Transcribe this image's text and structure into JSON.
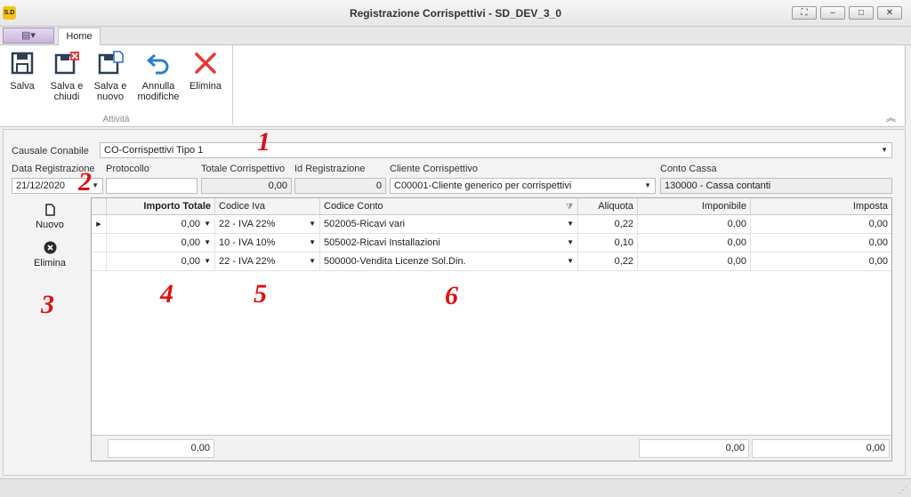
{
  "window": {
    "logo_text": "S.D",
    "title": "Registrazione Corrispettivi - SD_DEV_3_0"
  },
  "tabs": [
    {
      "label": "Home"
    }
  ],
  "ribbon": {
    "group_label": "Attività",
    "buttons": [
      {
        "line1": "Salva",
        "line2": ""
      },
      {
        "line1": "Salva e",
        "line2": "chiudi"
      },
      {
        "line1": "Salva e",
        "line2": "nuovo"
      },
      {
        "line1": "Annulla",
        "line2": "modifiche"
      },
      {
        "line1": "Elimina",
        "line2": ""
      }
    ]
  },
  "form": {
    "causale": {
      "label": "Causale Conabile",
      "value": "CO-Corrispettivi Tipo 1"
    },
    "data_registrazione": {
      "label": "Data Registrazione",
      "value": "21/12/2020"
    },
    "protocollo": {
      "label": "Protocollo",
      "value": ""
    },
    "totale_corrispettivo": {
      "label": "Totale Corrispettivo",
      "value": "0,00"
    },
    "id_registrazione": {
      "label": "Id Registrazione",
      "value": "0"
    },
    "cliente_corrispettivo": {
      "label": "Cliente Corrispettivo",
      "value": "C00001-Cliente generico per corrispettivi"
    },
    "conto_cassa": {
      "label": "Conto Cassa",
      "value": "130000 - Cassa contanti"
    }
  },
  "side_actions": {
    "new_label": "Nuovo",
    "delete_label": "Elimina"
  },
  "annotations": [
    "1",
    "2",
    "3",
    "4",
    "5",
    "6"
  ],
  "grid": {
    "columns": [
      "Importo Totale",
      "Codice Iva",
      "Codice Conto",
      "Aliquota",
      "Imponibile",
      "Imposta"
    ],
    "rows": [
      {
        "importo": "0,00",
        "iva": "22 - IVA 22%",
        "conto": "502005-Ricavi vari",
        "aliquota": "0,22",
        "imponibile": "0,00",
        "imposta": "0,00"
      },
      {
        "importo": "0,00",
        "iva": "10 - IVA 10%",
        "conto": "505002-Ricavi Installazioni",
        "aliquota": "0,10",
        "imponibile": "0,00",
        "imposta": "0,00"
      },
      {
        "importo": "0,00",
        "iva": "22 - IVA 22%",
        "conto": "500000-Vendita Licenze Sol.Din.",
        "aliquota": "0,22",
        "imponibile": "0,00",
        "imposta": "0,00"
      }
    ],
    "totals": {
      "importo": "0,00",
      "imponibile": "0,00",
      "imposta": "0,00"
    }
  }
}
